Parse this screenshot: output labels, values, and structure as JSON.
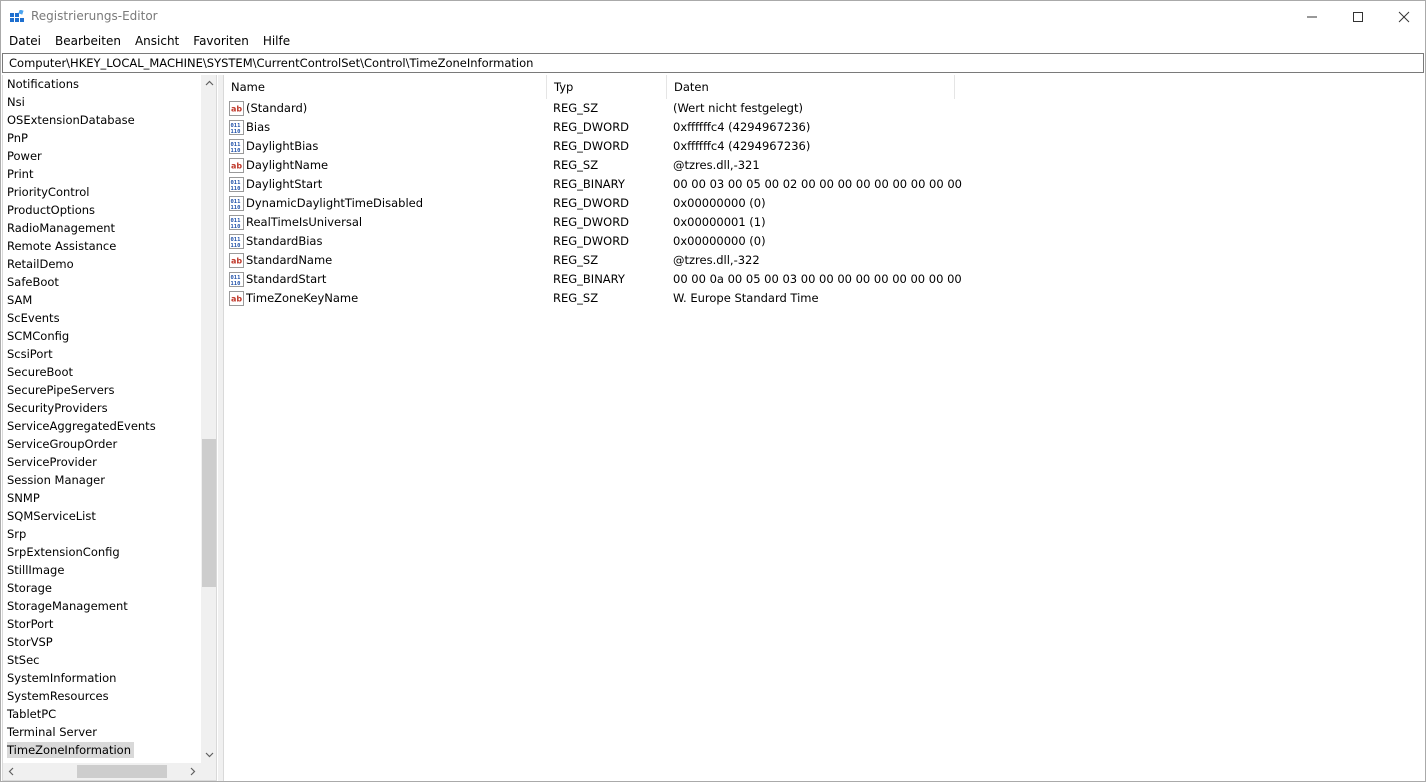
{
  "window": {
    "title": "Registrierungs-Editor"
  },
  "menu": [
    "Datei",
    "Bearbeiten",
    "Ansicht",
    "Favoriten",
    "Hilfe"
  ],
  "address": "Computer\\HKEY_LOCAL_MACHINE\\SYSTEM\\CurrentControlSet\\Control\\TimeZoneInformation",
  "tree": {
    "items": [
      "Notifications",
      "Nsi",
      "OSExtensionDatabase",
      "PnP",
      "Power",
      "Print",
      "PriorityControl",
      "ProductOptions",
      "RadioManagement",
      "Remote Assistance",
      "RetailDemo",
      "SafeBoot",
      "SAM",
      "ScEvents",
      "SCMConfig",
      "ScsiPort",
      "SecureBoot",
      "SecurePipeServers",
      "SecurityProviders",
      "ServiceAggregatedEvents",
      "ServiceGroupOrder",
      "ServiceProvider",
      "Session Manager",
      "SNMP",
      "SQMServiceList",
      "Srp",
      "SrpExtensionConfig",
      "StillImage",
      "Storage",
      "StorageManagement",
      "StorPort",
      "StorVSP",
      "StSec",
      "SystemInformation",
      "SystemResources",
      "TabletPC",
      "Terminal Server",
      "TimeZoneInformation"
    ],
    "selected": "TimeZoneInformation"
  },
  "list": {
    "columns": {
      "name": "Name",
      "type": "Typ",
      "data": "Daten"
    },
    "rows": [
      {
        "icon": "string-value-icon",
        "name": "(Standard)",
        "type": "REG_SZ",
        "data": "(Wert nicht festgelegt)"
      },
      {
        "icon": "binary-value-icon",
        "name": "Bias",
        "type": "REG_DWORD",
        "data": "0xffffffc4 (4294967236)"
      },
      {
        "icon": "binary-value-icon",
        "name": "DaylightBias",
        "type": "REG_DWORD",
        "data": "0xffffffc4 (4294967236)"
      },
      {
        "icon": "string-value-icon",
        "name": "DaylightName",
        "type": "REG_SZ",
        "data": "@tzres.dll,-321"
      },
      {
        "icon": "binary-value-icon",
        "name": "DaylightStart",
        "type": "REG_BINARY",
        "data": "00 00 03 00 05 00 02 00 00 00 00 00 00 00 00 00"
      },
      {
        "icon": "binary-value-icon",
        "name": "DynamicDaylightTimeDisabled",
        "type": "REG_DWORD",
        "data": "0x00000000 (0)"
      },
      {
        "icon": "binary-value-icon",
        "name": "RealTimeIsUniversal",
        "type": "REG_DWORD",
        "data": "0x00000001 (1)"
      },
      {
        "icon": "binary-value-icon",
        "name": "StandardBias",
        "type": "REG_DWORD",
        "data": "0x00000000 (0)"
      },
      {
        "icon": "string-value-icon",
        "name": "StandardName",
        "type": "REG_SZ",
        "data": "@tzres.dll,-322"
      },
      {
        "icon": "binary-value-icon",
        "name": "StandardStart",
        "type": "REG_BINARY",
        "data": "00 00 0a 00 05 00 03 00 00 00 00 00 00 00 00 00"
      },
      {
        "icon": "string-value-icon",
        "name": "TimeZoneKeyName",
        "type": "REG_SZ",
        "data": "W. Europe Standard Time"
      }
    ]
  }
}
